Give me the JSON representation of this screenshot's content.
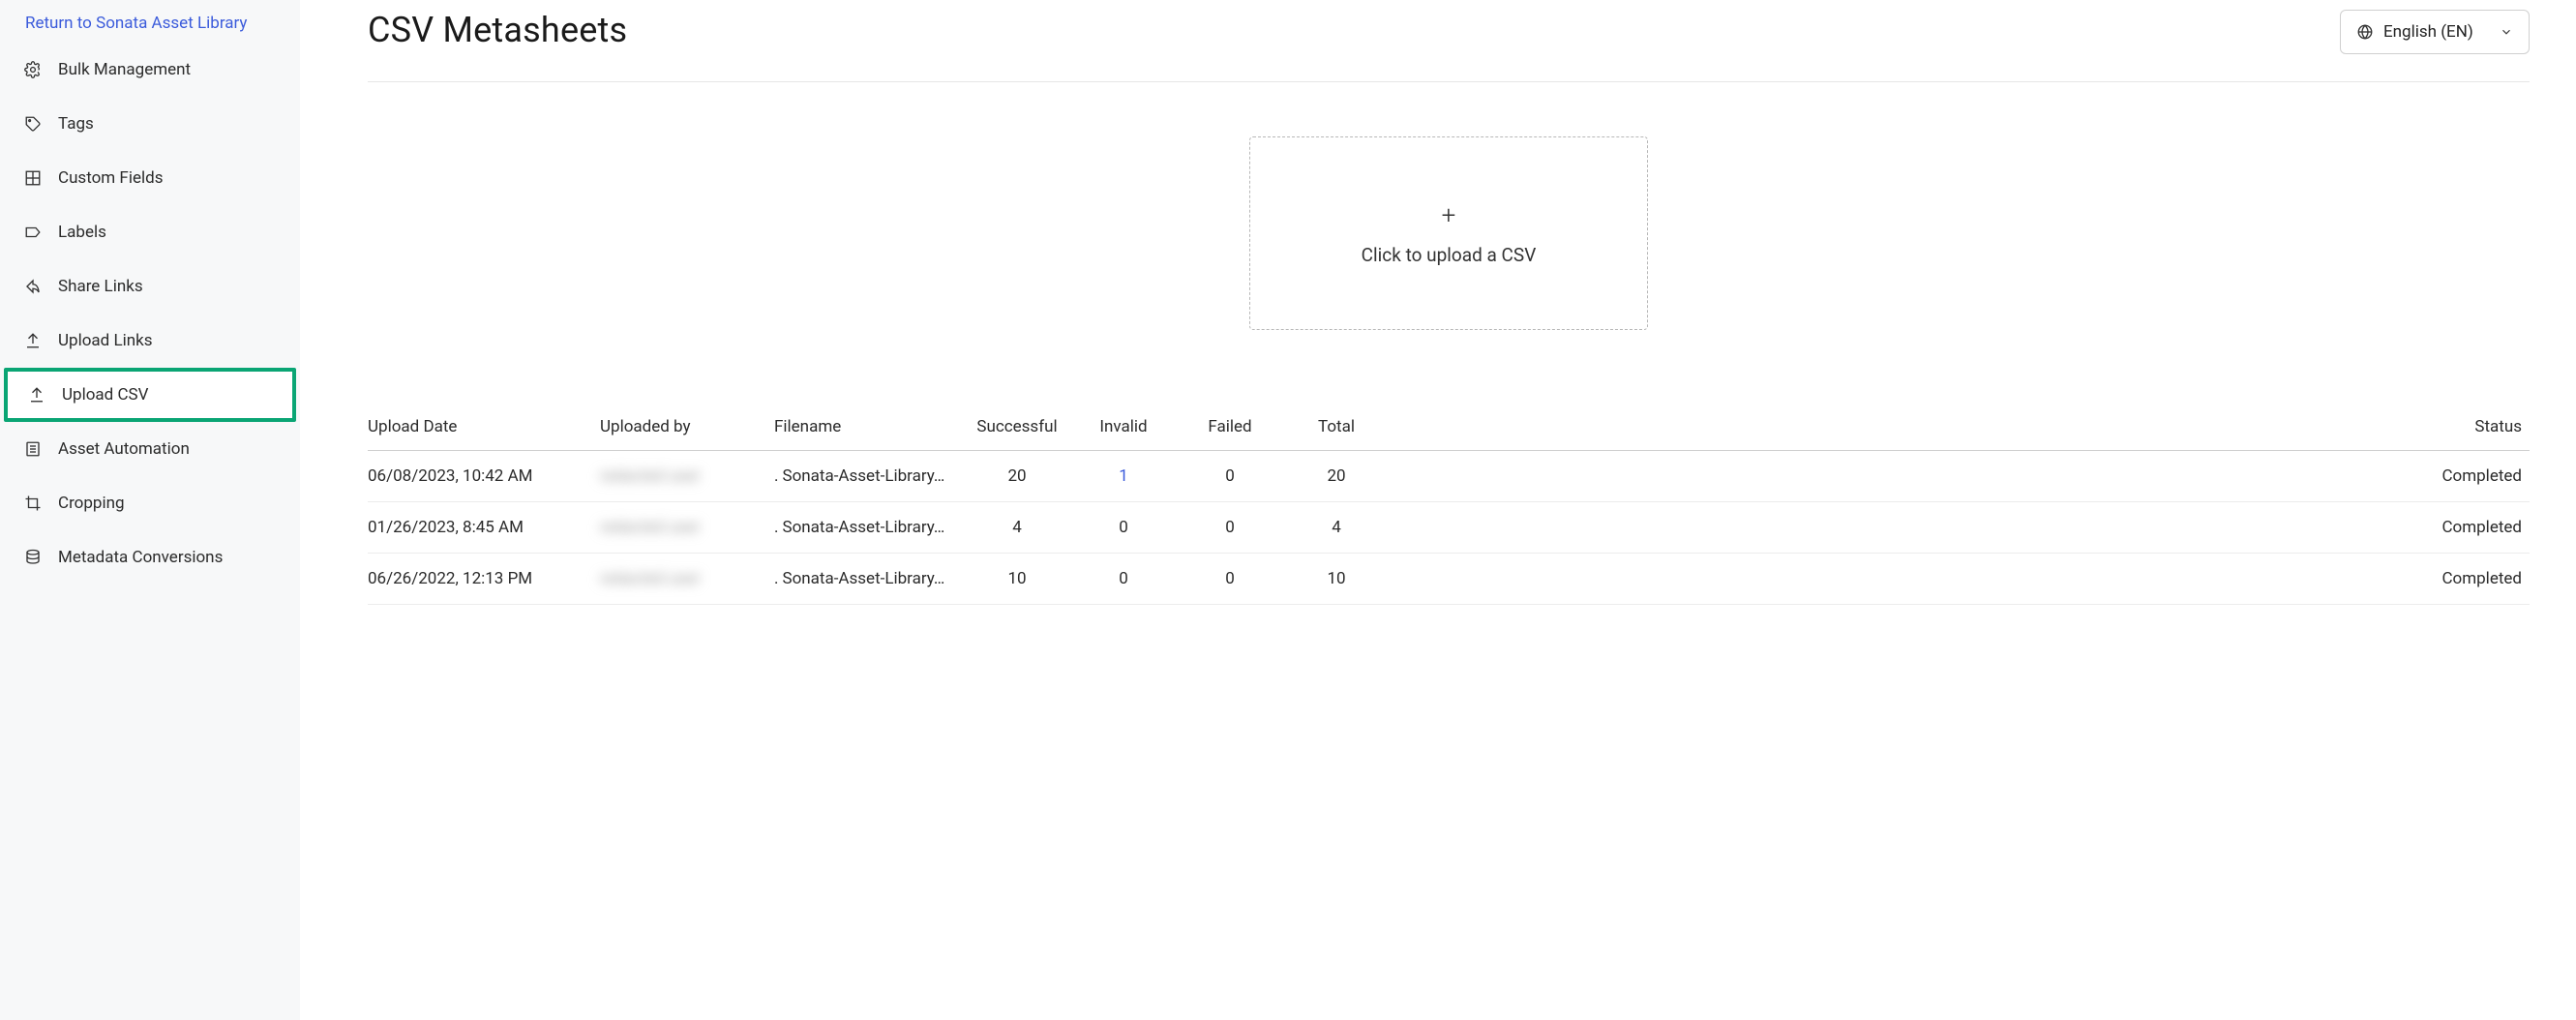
{
  "sidebar": {
    "return_link": "Return to Sonata Asset Library",
    "items": [
      {
        "label": "Bulk Management"
      },
      {
        "label": "Tags"
      },
      {
        "label": "Custom Fields"
      },
      {
        "label": "Labels"
      },
      {
        "label": "Share Links"
      },
      {
        "label": "Upload Links"
      },
      {
        "label": "Upload CSV"
      },
      {
        "label": "Asset Automation"
      },
      {
        "label": "Cropping"
      },
      {
        "label": "Metadata Conversions"
      }
    ]
  },
  "header": {
    "title": "CSV Metasheets",
    "language": "English (EN)"
  },
  "upload": {
    "label": "Click to upload a CSV"
  },
  "table": {
    "headers": {
      "upload_date": "Upload Date",
      "uploaded_by": "Uploaded by",
      "filename": "Filename",
      "successful": "Successful",
      "invalid": "Invalid",
      "failed": "Failed",
      "total": "Total",
      "status": "Status"
    },
    "rows": [
      {
        "upload_date": "06/08/2023, 10:42 AM",
        "uploaded_by": "redacted user",
        "filename": "Sonata-Asset-Library…",
        "successful": "20",
        "invalid": "1",
        "invalid_link": true,
        "failed": "0",
        "total": "20",
        "status": "Completed"
      },
      {
        "upload_date": "01/26/2023, 8:45 AM",
        "uploaded_by": "redacted user",
        "filename": "Sonata-Asset-Library…",
        "successful": "4",
        "invalid": "0",
        "invalid_link": false,
        "failed": "0",
        "total": "4",
        "status": "Completed"
      },
      {
        "upload_date": "06/26/2022, 12:13 PM",
        "uploaded_by": "redacted user",
        "filename": "Sonata-Asset-Library…",
        "successful": "10",
        "invalid": "0",
        "invalid_link": false,
        "failed": "0",
        "total": "10",
        "status": "Completed"
      }
    ]
  }
}
